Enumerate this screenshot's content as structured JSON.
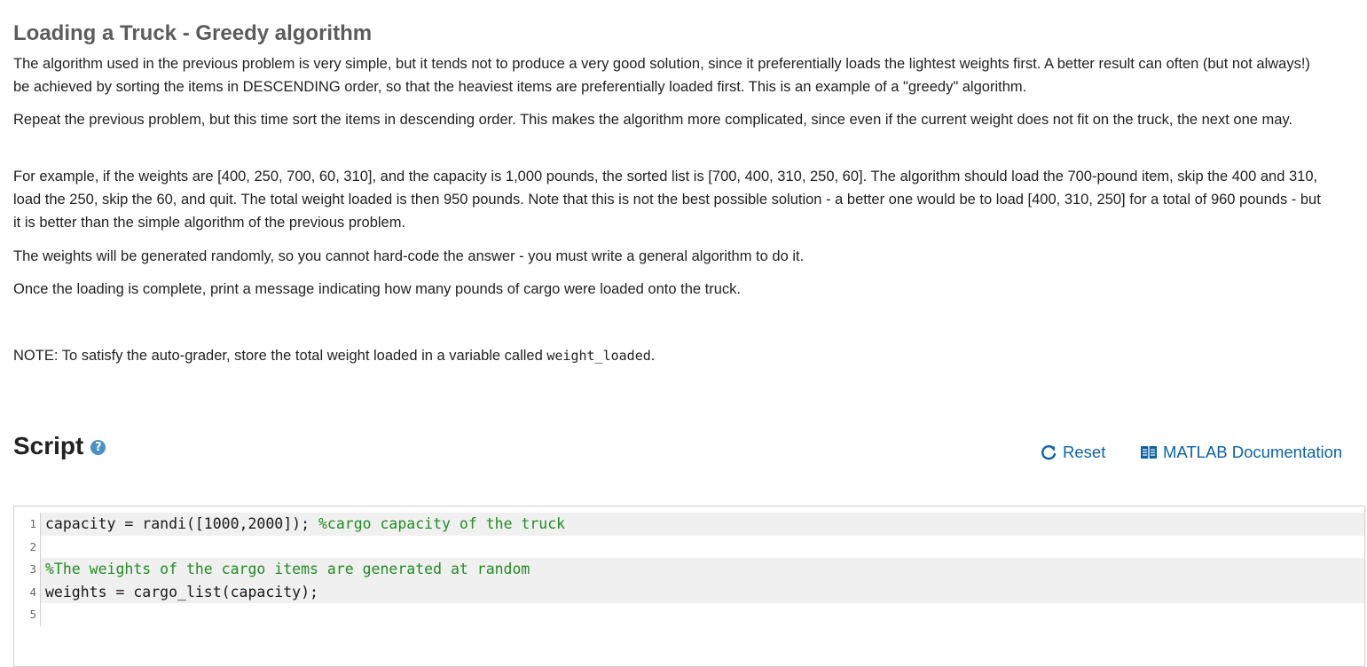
{
  "problem": {
    "title": "Loading a Truck - Greedy algorithm",
    "paragraphs": [
      "The algorithm used in the previous problem is very simple, but it tends not to produce a very good solution, since it preferentially loads the lightest weights first. A better result can often (but not always!) be achieved by sorting the items in DESCENDING order, so that the heaviest items are preferentially loaded first. This is an example of a \"greedy\" algorithm.",
      "Repeat the previous problem, but this time sort the items in descending order. This makes the algorithm more complicated, since even if the current weight does not fit on the truck, the next one may.",
      "For example, if the weights are  [400, 250, 700,  60, 310], and the capacity is 1,000 pounds, the sorted list is [700,  400, 310, 250,  60]. The algorithm should load the 700-pound item, skip the 400 and 310, load the 250, skip the 60, and quit. The total weight loaded is then 950 pounds. Note that this is not the best possible solution - a better one would be to load [400, 310, 250] for a total of 960 pounds - but it is better than the simple algorithm of the previous problem.",
      "The weights will be generated randomly, so you cannot hard-code the answer - you must write a general algorithm to do it.",
      "Once the loading is complete, print a message indicating how many pounds of cargo were loaded onto the truck."
    ],
    "note_prefix": "NOTE: To satisfy the auto-grader, store the total weight loaded in a variable called ",
    "note_var": "weight_loaded",
    "note_suffix": "."
  },
  "script": {
    "title": "Script",
    "help_icon": "?",
    "reset_label": "Reset",
    "docs_label": "MATLAB Documentation",
    "lines": [
      {
        "num": "1",
        "code": "capacity = randi([1000,2000]); ",
        "comment": "%cargo capacity of the truck"
      },
      {
        "num": "2",
        "code": "",
        "comment": ""
      },
      {
        "num": "3",
        "code": "",
        "comment": "%The weights of the cargo items are generated at random"
      },
      {
        "num": "4",
        "code": "weights = cargo_list(capacity);",
        "comment": ""
      },
      {
        "num": "5",
        "code": "",
        "comment": ""
      }
    ]
  },
  "colors": {
    "link": "#0d62a6",
    "comment": "#228b22",
    "help_icon": "#4a90c2"
  }
}
